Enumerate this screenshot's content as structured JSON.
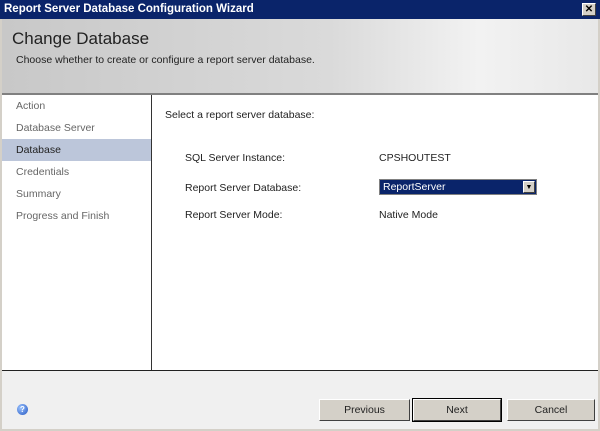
{
  "window": {
    "title": "Report Server Database Configuration Wizard",
    "close_label": "✕"
  },
  "header": {
    "title": "Change Database",
    "subtitle": "Choose whether to create or configure a report server database."
  },
  "nav": {
    "items": [
      {
        "label": "Action"
      },
      {
        "label": "Database Server"
      },
      {
        "label": "Database",
        "selected": true
      },
      {
        "label": "Credentials"
      },
      {
        "label": "Summary"
      },
      {
        "label": "Progress and Finish"
      }
    ]
  },
  "main": {
    "prompt": "Select a report server database:",
    "sql_instance_label": "SQL Server Instance:",
    "sql_instance_value": "CPSHOUTEST",
    "database_label": "Report Server Database:",
    "database_value": "ReportServer",
    "mode_label": "Report Server Mode:",
    "mode_value": "Native Mode"
  },
  "footer": {
    "help_icon": "?",
    "previous": "Previous",
    "next": "Next",
    "cancel": "Cancel"
  }
}
